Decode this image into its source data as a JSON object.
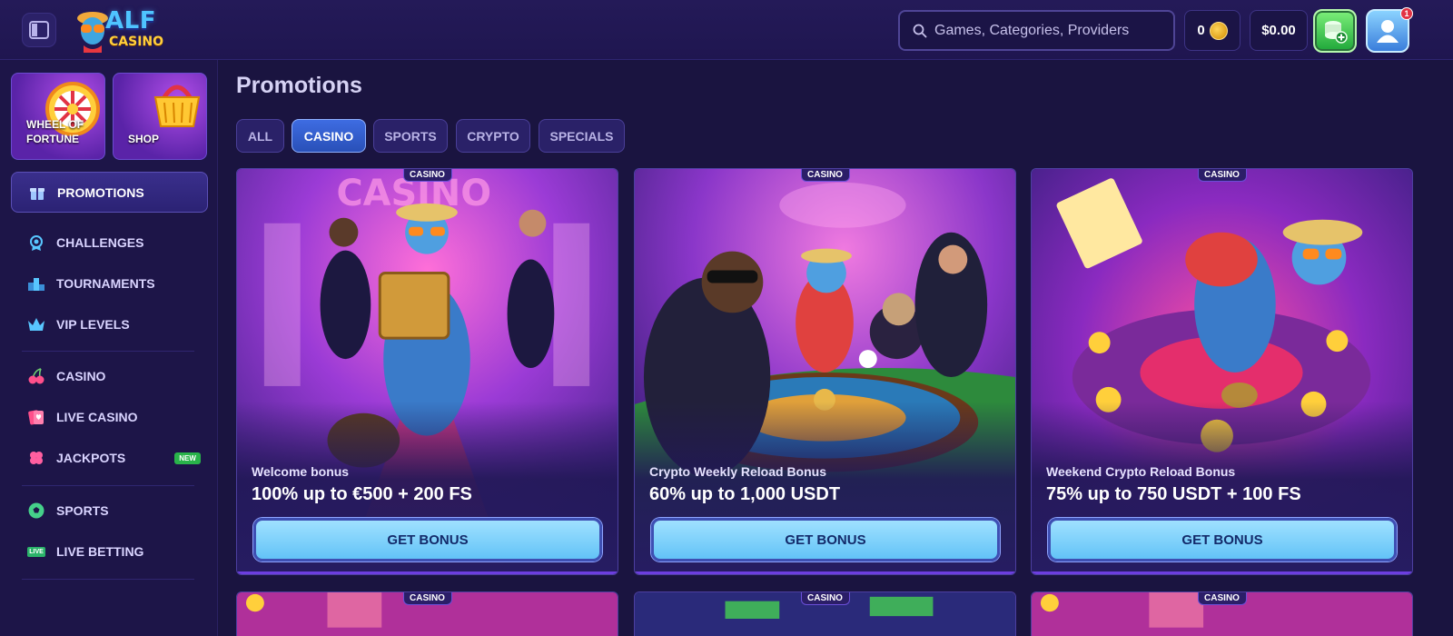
{
  "header": {
    "logo_main": "ALF",
    "logo_sub": "CASINO",
    "search_placeholder": "Games, Categories, Providers",
    "coins": "0",
    "balance": "$0.00",
    "notification_count": "1"
  },
  "sidebar": {
    "tiles": [
      {
        "label": "WHEEL OF FORTUNE",
        "icon": "wheel-of-fortune-icon"
      },
      {
        "label": "SHOP",
        "icon": "basket-icon"
      }
    ],
    "active_item": {
      "label": "PROMOTIONS",
      "icon": "gift-icon"
    },
    "items": [
      {
        "label": "CHALLENGES",
        "icon": "medal-icon"
      },
      {
        "label": "TOURNAMENTS",
        "icon": "podium-icon"
      },
      {
        "label": "VIP LEVELS",
        "icon": "crown-icon"
      },
      {
        "label": "CASINO",
        "icon": "cherries-icon"
      },
      {
        "label": "LIVE CASINO",
        "icon": "cards-icon"
      },
      {
        "label": "JACKPOTS",
        "icon": "clover-icon",
        "badge": "NEW"
      },
      {
        "label": "SPORTS",
        "icon": "soccer-ball-icon"
      },
      {
        "label": "LIVE BETTING",
        "icon": "live-icon",
        "icon_text": "LIVE"
      }
    ]
  },
  "main": {
    "title": "Promotions",
    "filters": [
      "ALL",
      "CASINO",
      "SPORTS",
      "CRYPTO",
      "SPECIALS"
    ],
    "active_filter": "CASINO",
    "cards": [
      {
        "tag": "CASINO",
        "subtitle": "Welcome bonus",
        "title": "100% up to €500 + 200 FS",
        "button": "GET BONUS"
      },
      {
        "tag": "CASINO",
        "subtitle": "Crypto Weekly Reload Bonus",
        "title": "60% up to 1,000 USDT",
        "button": "GET BONUS"
      },
      {
        "tag": "CASINO",
        "subtitle": "Weekend Crypto Reload Bonus",
        "title": "75% up to 750 USDT + 100 FS",
        "button": "GET BONUS"
      }
    ],
    "peek_cards": [
      {
        "tag": "CASINO"
      },
      {
        "tag": "CASINO"
      },
      {
        "tag": "CASINO"
      }
    ]
  },
  "colors": {
    "background": "#1a1440",
    "accent_blue": "#3e6ce2",
    "button_cyan": "#63c3f7",
    "badge_green": "#29b34a"
  }
}
